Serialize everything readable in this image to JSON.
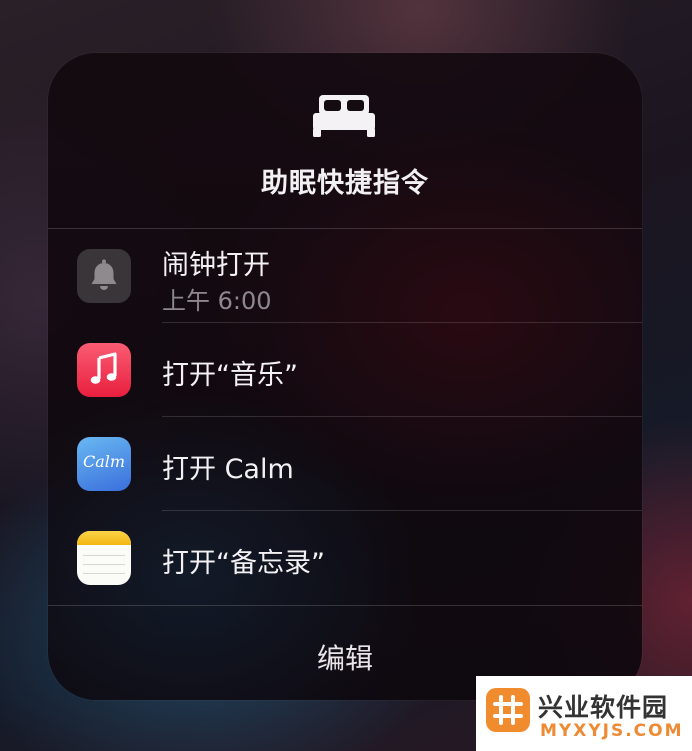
{
  "panel": {
    "icon": "bed-icon",
    "title": "助眠快捷指令"
  },
  "items": [
    {
      "icon": "bell-icon",
      "label": "闹钟打开",
      "sublabel": "上午 6:00"
    },
    {
      "icon": "music-app-icon",
      "label": "打开“音乐”"
    },
    {
      "icon": "calm-app-icon",
      "label": "打开 Calm",
      "icon_text": "Calm"
    },
    {
      "icon": "notes-app-icon",
      "label": "打开“备忘录”"
    }
  ],
  "footer": {
    "edit_label": "编辑"
  },
  "watermark": {
    "name": "兴业软件园",
    "domain": "MYXYJS.COM"
  },
  "colors": {
    "music": "#f2334f",
    "calm": "#3b7fe0",
    "notes_top": "#f7c51e",
    "watermark_accent": "#f08c2e"
  }
}
